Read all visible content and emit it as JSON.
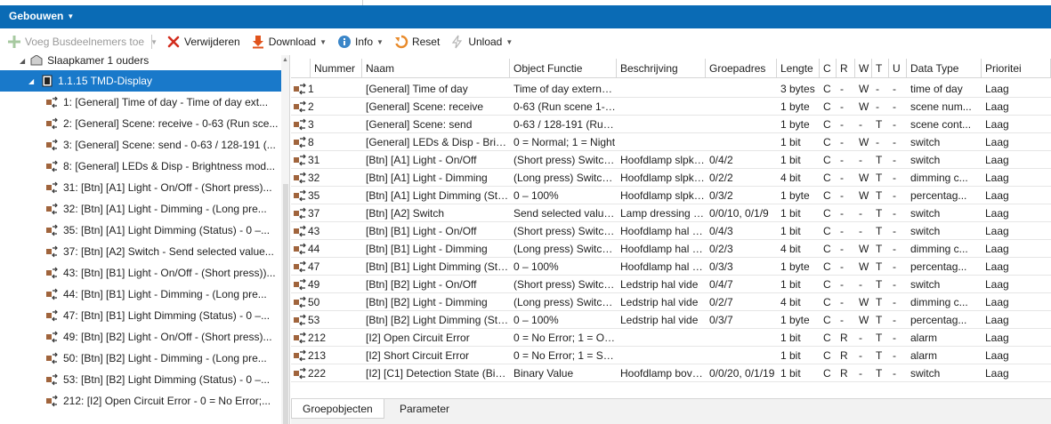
{
  "header": {
    "title": "Gebouwen"
  },
  "toolbar": {
    "add_label": "Voeg Busdeelnemers toe",
    "delete_label": "Verwijderen",
    "download_label": "Download",
    "info_label": "Info",
    "reset_label": "Reset",
    "unload_label": "Unload"
  },
  "tree": {
    "items": [
      {
        "label": "Slaapkamer 1 ouders"
      },
      {
        "label": "1.1.15 TMD-Display"
      },
      {
        "label": "1: [General] Time of day - Time of day ext..."
      },
      {
        "label": "2: [General] Scene: receive - 0-63 (Run sce..."
      },
      {
        "label": "3: [General] Scene: send - 0-63 / 128-191 (..."
      },
      {
        "label": "8: [General] LEDs & Disp - Brightness mod..."
      },
      {
        "label": "31: [Btn] [A1] Light - On/Off - (Short press)..."
      },
      {
        "label": "32: [Btn] [A1] Light - Dimming - (Long pre..."
      },
      {
        "label": "35: [Btn] [A1] Light Dimming (Status) - 0 –..."
      },
      {
        "label": "37: [Btn] [A2] Switch - Send selected value..."
      },
      {
        "label": "43: [Btn] [B1] Light - On/Off - (Short press))..."
      },
      {
        "label": "44: [Btn] [B1] Light - Dimming - (Long pre..."
      },
      {
        "label": "47: [Btn] [B1] Light Dimming (Status) - 0 –..."
      },
      {
        "label": "49: [Btn] [B2] Light - On/Off - (Short press)..."
      },
      {
        "label": "50: [Btn] [B2] Light - Dimming - (Long pre..."
      },
      {
        "label": "53: [Btn] [B2] Light Dimming (Status) - 0 –..."
      },
      {
        "label": "212: [I2] Open Circuit Error - 0 = No Error;..."
      }
    ]
  },
  "grid": {
    "columns": [
      "Nummer",
      "Naam",
      "Object Functie",
      "Beschrijving",
      "Groepadres",
      "Lengte",
      "C",
      "R",
      "W",
      "T",
      "U",
      "Data Type",
      "Prioritei"
    ],
    "rows": [
      [
        "1",
        "[General] Time of day",
        "Time of day external r...",
        "",
        "",
        "3 bytes",
        "C",
        "-",
        "W",
        "-",
        "-",
        "time of day",
        "Laag"
      ],
      [
        "2",
        "[General] Scene: receive",
        "0-63 (Run scene 1-64)",
        "",
        "",
        "1 byte",
        "C",
        "-",
        "W",
        "-",
        "-",
        "scene num...",
        "Laag"
      ],
      [
        "3",
        "[General] Scene: send",
        "0-63 / 128-191 (Run/S...",
        "",
        "",
        "1 byte",
        "C",
        "-",
        "-",
        "T",
        "-",
        "scene cont...",
        "Laag"
      ],
      [
        "8",
        "[General] LEDs & Disp - Bright...",
        "0 = Normal; 1 = Night",
        "",
        "",
        "1 bit",
        "C",
        "-",
        "W",
        "-",
        "-",
        "switch",
        "Laag"
      ],
      [
        "31",
        "[Btn] [A1] Light - On/Off",
        "(Short press) Switch b...",
        "Hoofdlamp slpk o...",
        "0/4/2",
        "1 bit",
        "C",
        "-",
        "-",
        "T",
        "-",
        "switch",
        "Laag"
      ],
      [
        "32",
        "[Btn] [A1] Light - Dimming",
        "(Long press) Switch b...",
        "Hoofdlamp slpk o...",
        "0/2/2",
        "4 bit",
        "C",
        "-",
        "W",
        "T",
        "-",
        "dimming c...",
        "Laag"
      ],
      [
        "35",
        "[Btn] [A1] Light Dimming (Stat...",
        "0 – 100%",
        "Hoofdlamp slpk o...",
        "0/3/2",
        "1 byte",
        "C",
        "-",
        "W",
        "T",
        "-",
        "percentag...",
        "Laag"
      ],
      [
        "37",
        "[Btn] [A2] Switch",
        "Send selected value o...",
        "Lamp dressing sl...",
        "0/0/10, 0/1/9",
        "1 bit",
        "C",
        "-",
        "-",
        "T",
        "-",
        "switch",
        "Laag"
      ],
      [
        "43",
        "[Btn] [B1] Light - On/Off",
        "(Short press) Switch b...",
        "Hoofdlamp hal b...",
        "0/4/3",
        "1 bit",
        "C",
        "-",
        "-",
        "T",
        "-",
        "switch",
        "Laag"
      ],
      [
        "44",
        "[Btn] [B1] Light - Dimming",
        "(Long press) Switch b...",
        "Hoofdlamp hal b...",
        "0/2/3",
        "4 bit",
        "C",
        "-",
        "W",
        "T",
        "-",
        "dimming c...",
        "Laag"
      ],
      [
        "47",
        "[Btn] [B1] Light Dimming (Stat...",
        "0 – 100%",
        "Hoofdlamp hal b...",
        "0/3/3",
        "1 byte",
        "C",
        "-",
        "W",
        "T",
        "-",
        "percentag...",
        "Laag"
      ],
      [
        "49",
        "[Btn] [B2] Light - On/Off",
        "(Short press) Switch b...",
        "Ledstrip hal vide",
        "0/4/7",
        "1 bit",
        "C",
        "-",
        "-",
        "T",
        "-",
        "switch",
        "Laag"
      ],
      [
        "50",
        "[Btn] [B2] Light - Dimming",
        "(Long press) Switch b...",
        "Ledstrip hal vide",
        "0/2/7",
        "4 bit",
        "C",
        "-",
        "W",
        "T",
        "-",
        "dimming c...",
        "Laag"
      ],
      [
        "53",
        "[Btn] [B2] Light Dimming (Stat...",
        "0 – 100%",
        "Ledstrip hal vide",
        "0/3/7",
        "1 byte",
        "C",
        "-",
        "W",
        "T",
        "-",
        "percentag...",
        "Laag"
      ],
      [
        "212",
        "[I2] Open Circuit Error",
        "0 = No Error; 1 = Op...",
        "",
        "",
        "1 bit",
        "C",
        "R",
        "-",
        "T",
        "-",
        "alarm",
        "Laag"
      ],
      [
        "213",
        "[I2] Short Circuit Error",
        "0 = No Error; 1 = Sho...",
        "",
        "",
        "1 bit",
        "C",
        "R",
        "-",
        "T",
        "-",
        "alarm",
        "Laag"
      ],
      [
        "222",
        "[I2] [C1] Detection State (Binary)",
        "Binary Value",
        "Hoofdlamp bove...",
        "0/0/20, 0/1/19",
        "1 bit",
        "C",
        "R",
        "-",
        "T",
        "-",
        "switch",
        "Laag"
      ]
    ]
  },
  "tabs": [
    {
      "label": "Groepobjecten"
    },
    {
      "label": "Parameter"
    }
  ],
  "colors": {
    "accent": "#0a6bb5",
    "selection": "#1979ca",
    "icon_brown": "#a0643c"
  }
}
